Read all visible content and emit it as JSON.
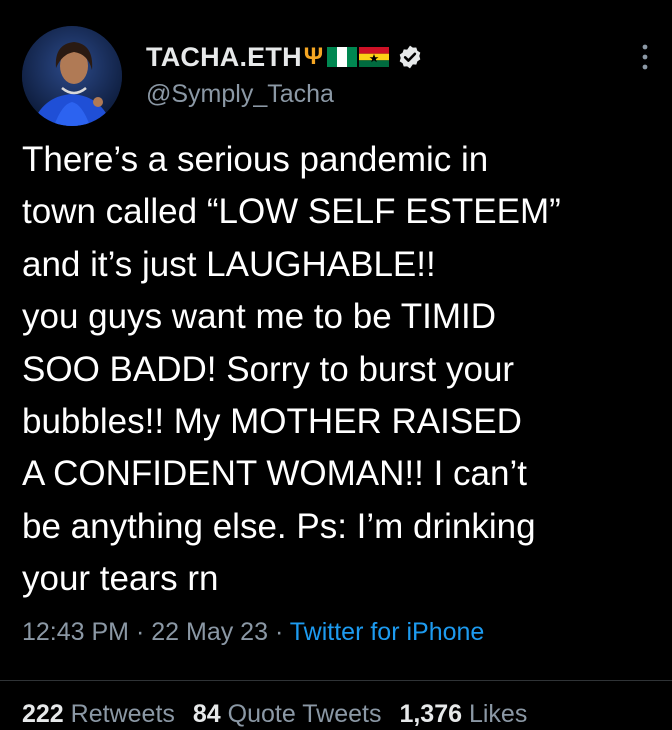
{
  "user": {
    "display_name": "TACHA.ETH",
    "name_emoji": [
      "trident-icon",
      "nigeria-flag-icon",
      "ghana-flag-icon"
    ],
    "handle": "@Symply_Tacha",
    "verified": true
  },
  "tweet": {
    "text": "There’s a serious pandemic in\ntown called “LOW SELF ESTEEM”\nand it’s just LAUGHABLE!!\nyou guys want me to be TIMID\nSOO BADD! Sorry to burst your\nbubbles!! My MOTHER RAISED\nA CONFIDENT WOMAN!! I can’t\nbe anything else. Ps: I’m drinking\nyour tears rn",
    "time": "12:43 PM",
    "separator": "·",
    "date": "22 May 23",
    "source": "Twitter for iPhone"
  },
  "stats": {
    "retweets_count": "222",
    "retweets_label": "Retweets",
    "quotes_count": "84",
    "quotes_label": "Quote Tweets",
    "likes_count": "1,376",
    "likes_label": "Likes"
  },
  "colors": {
    "background": "#000000",
    "text": "#ffffff",
    "secondary": "#8b98a5",
    "link": "#1d9bf0"
  }
}
